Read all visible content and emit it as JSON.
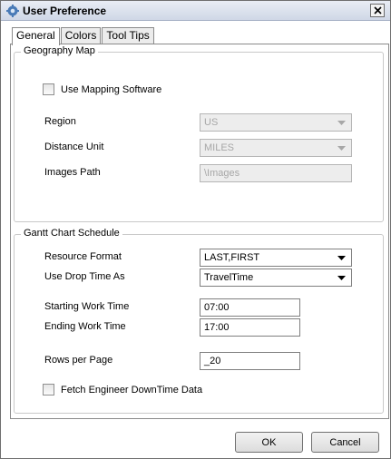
{
  "window": {
    "title": "User Preference"
  },
  "tabs": [
    {
      "label": "General",
      "active": true
    },
    {
      "label": "Colors",
      "active": false
    },
    {
      "label": "Tool Tips",
      "active": false
    }
  ],
  "geography": {
    "title": "Geography Map",
    "use_mapping_label": "Use Mapping Software",
    "use_mapping_checked": false,
    "region_label": "Region",
    "region_value": "US",
    "distance_label": "Distance Unit",
    "distance_value": "MILES",
    "images_label": "Images Path",
    "images_value": "\\Images"
  },
  "gantt": {
    "title": "Gantt Chart Schedule",
    "resource_format_label": "Resource Format",
    "resource_format_value": "LAST,FIRST",
    "drop_time_label": "Use Drop Time As",
    "drop_time_value": "TravelTime",
    "start_time_label": "Starting Work Time",
    "start_time_value": "07:00",
    "end_time_label": "Ending Work Time",
    "end_time_value": "17:00",
    "rows_label": "Rows per Page",
    "rows_value": "_20",
    "fetch_label": "Fetch Engineer DownTime Data",
    "fetch_checked": false
  },
  "buttons": {
    "ok": "OK",
    "cancel": "Cancel"
  },
  "colors": {
    "titlebar": "#cfd7e6",
    "disabled_fill": "#ededed",
    "disabled_text": "#a7a7a7"
  },
  "icons": {
    "app": "gear-icon",
    "close": "close-icon",
    "dropdown": "chevron-down-icon"
  }
}
